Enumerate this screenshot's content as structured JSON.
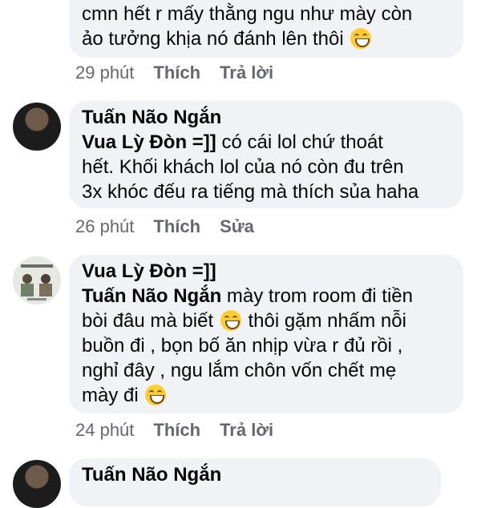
{
  "comments": [
    {
      "text_lines": [
        "cmn hết r mấy thằng ngu như mày còn",
        "ảo tưởng khịa nó đánh lên thôi"
      ],
      "time": "29 phút",
      "like": "Thích",
      "reply": "Trả lời"
    },
    {
      "author": "Tuấn Não Ngắn",
      "mention": "Vua Lỳ Đòn =]]",
      "text_first": "có cái lol chứ thoát",
      "text_lines": [
        "hết. Khối khách lol của nó còn đu trên",
        "3x khóc đếu ra tiếng mà thích sủa haha"
      ],
      "time": "26 phút",
      "like": "Thích",
      "edit": "Sửa"
    },
    {
      "author": "Vua Lỳ Đòn =]]",
      "mention": "Tuấn Não Ngắn",
      "text_first": "mày trom room đi tiền",
      "line2_a": "bòi đâu mà biết",
      "line2_b": "thôi gặm nhấm nỗi",
      "text_lines": [
        "buồn đi , bọn bố ăn nhịp vừa r đủ rồi ,",
        "nghỉ đây , ngu lắm chôn vốn chết mẹ"
      ],
      "last_line": "mày đi",
      "time": "24 phút",
      "like": "Thích",
      "reply": "Trả lời"
    },
    {
      "author": "Tuấn Não Ngắn"
    }
  ],
  "emoji_icon": "grinning-face-emoji",
  "colors": {
    "bubble": "#f0f2f5",
    "meta": "#65676b",
    "text": "#050505"
  }
}
